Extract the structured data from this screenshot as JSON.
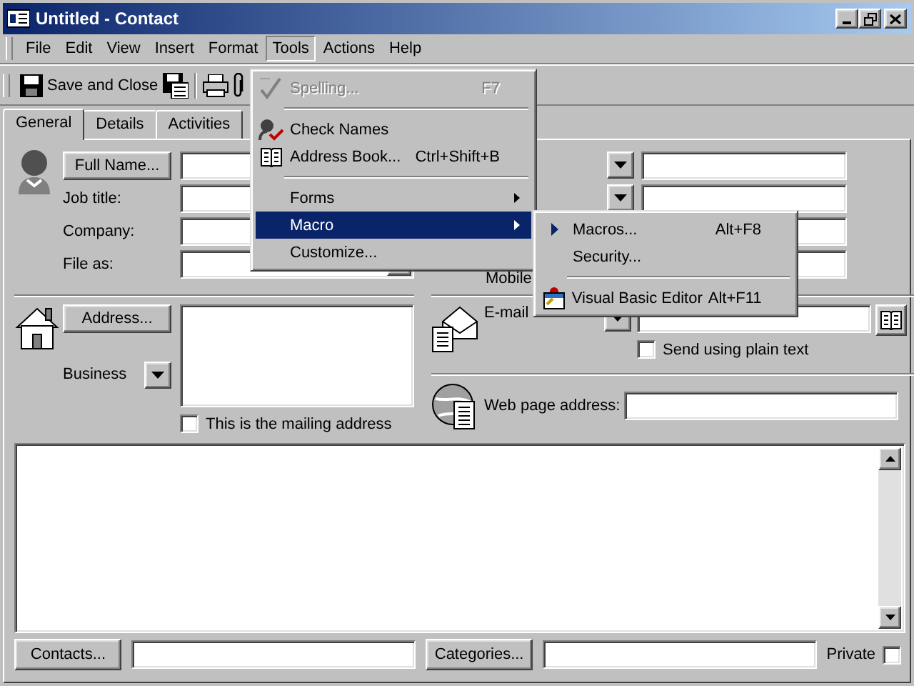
{
  "window": {
    "title": "Untitled - Contact"
  },
  "menu_bar": [
    {
      "label": "File",
      "selected": false
    },
    {
      "label": "Edit",
      "selected": false
    },
    {
      "label": "View",
      "selected": false
    },
    {
      "label": "Insert",
      "selected": false
    },
    {
      "label": "Format",
      "selected": false
    },
    {
      "label": "Tools",
      "selected": true
    },
    {
      "label": "Actions",
      "selected": false
    },
    {
      "label": "Help",
      "selected": false
    }
  ],
  "toolbar": {
    "save_and_close": "Save and Close"
  },
  "tabs": [
    {
      "label": "General",
      "selected": true
    },
    {
      "label": "Details",
      "selected": false
    },
    {
      "label": "Activities",
      "selected": false
    }
  ],
  "name_section": {
    "full_name_button": "Full Name...",
    "fields": [
      {
        "label": "Job title:",
        "kind": "text"
      },
      {
        "label": "Company:",
        "kind": "text"
      },
      {
        "label": "File as:",
        "kind": "dropdown"
      }
    ]
  },
  "phone_rows": [
    {
      "type_button": true
    },
    {
      "type_button": true
    },
    {
      "type_button": false
    },
    {
      "type_button": false,
      "label": "Mobile"
    }
  ],
  "address_section": {
    "button": "Address...",
    "type_label": "Business",
    "mailing_checkbox": {
      "label": "This is the mailing address",
      "checked": false
    }
  },
  "email_section": {
    "label": "E-mail",
    "plain_text_checkbox": {
      "label": "Send using plain text",
      "checked": false
    }
  },
  "web_section": {
    "label": "Web page address:"
  },
  "footer": {
    "contacts_button": "Contacts...",
    "categories_button": "Categories...",
    "private": {
      "label": "Private",
      "checked": false
    }
  },
  "tools_menu": [
    {
      "kind": "item",
      "label": "Spelling...",
      "shortcut": "F7",
      "disabled": true,
      "selected": false
    },
    {
      "kind": "separator"
    },
    {
      "kind": "item",
      "label": "Check Names",
      "disabled": false,
      "selected": false
    },
    {
      "kind": "item",
      "label": "Address Book...",
      "shortcut": "Ctrl+Shift+B",
      "disabled": false,
      "selected": false
    },
    {
      "kind": "separator"
    },
    {
      "kind": "submenu",
      "label": "Forms",
      "disabled": false,
      "selected": false
    },
    {
      "kind": "submenu",
      "label": "Macro",
      "disabled": false,
      "selected": true
    },
    {
      "kind": "item",
      "label": "Customize...",
      "disabled": false,
      "selected": false
    }
  ],
  "macro_submenu": [
    {
      "kind": "item",
      "label": "Macros...",
      "shortcut": "Alt+F8",
      "disabled": false,
      "selected": false
    },
    {
      "kind": "item",
      "label": "Security...",
      "disabled": false,
      "selected": false
    },
    {
      "kind": "separator"
    },
    {
      "kind": "item",
      "label": "Visual Basic Editor",
      "shortcut": "Alt+F11",
      "disabled": false,
      "selected": false
    }
  ]
}
